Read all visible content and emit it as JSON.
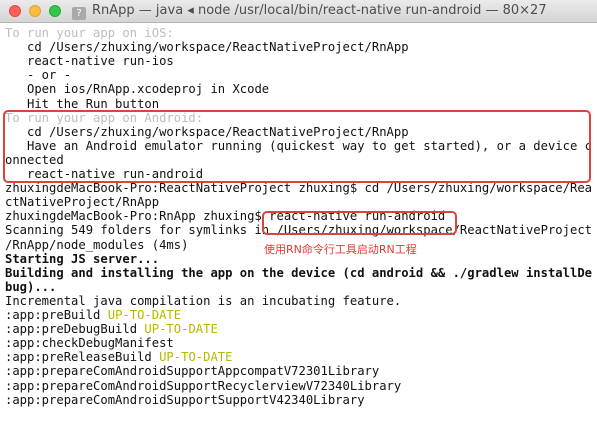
{
  "window": {
    "title": "RnApp — java ◂ node /usr/local/bin/react-native run-android — 80×27"
  },
  "terminal": {
    "lines": [
      {
        "text": "To run your app on iOS:",
        "style": "comment"
      },
      {
        "text": "   cd /Users/zhuxing/workspace/ReactNativeProject/RnApp",
        "style": "normal"
      },
      {
        "text": "   react-native run-ios",
        "style": "normal"
      },
      {
        "text": "   - or -",
        "style": "normal"
      },
      {
        "text": "   Open ios/RnApp.xcodeproj in Xcode",
        "style": "normal"
      },
      {
        "text": "   Hit the Run button",
        "style": "normal"
      },
      {
        "text": "To run your app on Android:",
        "style": "comment"
      },
      {
        "text": "   cd /Users/zhuxing/workspace/ReactNativeProject/RnApp",
        "style": "normal"
      },
      {
        "text": "   Have an Android emulator running (quickest way to get started), or a device c",
        "style": "normal"
      },
      {
        "text": "onnected",
        "style": "normal"
      },
      {
        "text": "   react-native run-android",
        "style": "normal"
      },
      {
        "text": "zhuxingdeMacBook-Pro:ReactNativeProject zhuxing$ cd /Users/zhuxing/workspace/Rea",
        "style": "normal"
      },
      {
        "text": "ctNativeProject/RnApp",
        "style": "normal"
      },
      {
        "text": "zhuxingdeMacBook-Pro:RnApp zhuxing$ react-native run-android",
        "style": "normal"
      },
      {
        "text": "Scanning 549 folders for symlinks in /Users/zhuxing/workspace/ReactNativeProject",
        "style": "normal"
      },
      {
        "text": "/RnApp/node_modules (4ms)",
        "style": "normal"
      },
      {
        "text": "Starting JS server...",
        "style": "bold"
      },
      {
        "text": "Building and installing the app on the device (cd android && ./gradlew installDe",
        "style": "bold"
      },
      {
        "text": "bug)...",
        "style": "bold"
      },
      {
        "text": "Incremental java compilation is an incubating feature.",
        "style": "normal"
      },
      {
        "text": ":app:preBuild ",
        "status": "UP-TO-DATE",
        "style": "normal"
      },
      {
        "text": ":app:preDebugBuild ",
        "status": "UP-TO-DATE",
        "style": "normal"
      },
      {
        "text": ":app:checkDebugManifest",
        "style": "normal"
      },
      {
        "text": ":app:preReleaseBuild ",
        "status": "UP-TO-DATE",
        "style": "normal"
      },
      {
        "text": ":app:prepareComAndroidSupportAppcompatV72301Library",
        "style": "normal"
      },
      {
        "text": ":app:prepareComAndroidSupportRecyclerviewV72340Library",
        "style": "normal"
      },
      {
        "text": ":app:prepareComAndroidSupportSupportV42340Library",
        "style": "normal"
      }
    ]
  },
  "annotation": {
    "text": "使用RN命令行工具启动RN工程"
  },
  "colors": {
    "highlight": "#d9453d",
    "up_to_date": "#b8b800",
    "comment": "#bdbdbd"
  }
}
